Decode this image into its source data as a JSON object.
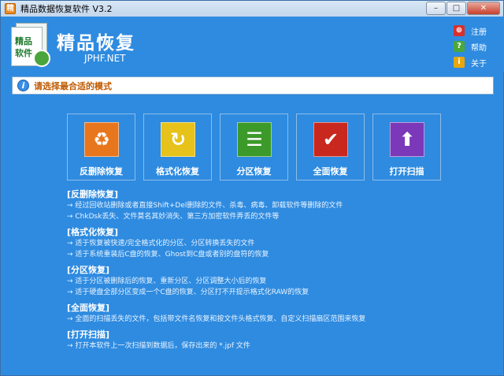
{
  "window": {
    "title": "精品数据恢复软件 V3.2",
    "controls": {
      "minimize": "–",
      "maximize": "□",
      "close": "✕"
    }
  },
  "header": {
    "logo_text": "精品软件",
    "app_name": "精品恢复",
    "app_subtitle": "JPHF.NET",
    "links": [
      {
        "label": "注册",
        "icon": "cart-icon",
        "color": "#d9302b",
        "glyph": "⊕"
      },
      {
        "label": "帮助",
        "icon": "help-icon",
        "color": "#4aa83a",
        "glyph": "?"
      },
      {
        "label": "关于",
        "icon": "info-icon",
        "color": "#e8a80c",
        "glyph": "i"
      }
    ]
  },
  "hint": {
    "text": "请选择最合适的模式"
  },
  "modes": [
    {
      "label": "反删除恢复",
      "icon": "recycle-icon",
      "color": "#e8761c",
      "glyph": "♻"
    },
    {
      "label": "格式化恢复",
      "icon": "refresh-icon",
      "color": "#e6c21a",
      "glyph": "↻"
    },
    {
      "label": "分区恢复",
      "icon": "checklist-icon",
      "color": "#3c9a2a",
      "glyph": "☰"
    },
    {
      "label": "全面恢复",
      "icon": "checkbox-icon",
      "color": "#c8281e",
      "glyph": "✔"
    },
    {
      "label": "打开扫描",
      "icon": "upload-arrow-icon",
      "color": "#7b38b8",
      "glyph": "⬆"
    }
  ],
  "descriptions": [
    {
      "title": "[反删除恢复]",
      "lines": [
        "→ 经过回收站删除或者直接Shift+Del删除的文件、杀毒、病毒、卸载软件等删除的文件",
        "→ ChkDsk丢失、文件莫名其妙消失、第三方加密软件弄丢的文件等"
      ]
    },
    {
      "title": "[格式化恢复]",
      "lines": [
        "→ 适于恢复被快速/完全格式化的分区、分区转换丢失的文件",
        "→ 适于系统重装后C盘的恢复、Ghost到C盘或者别的盘符的恢复"
      ]
    },
    {
      "title": "[分区恢复]",
      "lines": [
        "→ 适于分区被删除后的恢复、重新分区、分区调整大小后的恢复",
        "→ 适于硬盘全部分区变成一个C盘的恢复、分区打不开提示格式化RAW的恢复"
      ]
    },
    {
      "title": "[全面恢复]",
      "lines": [
        "→ 全面的扫描丢失的文件，包括带文件名恢复和按文件头格式恢复、自定义扫描扇区范围来恢复"
      ]
    },
    {
      "title": "[打开扫描]",
      "lines": [
        "→ 打开本软件上一次扫描到数据后，保存出来的 *.jpf 文件"
      ]
    }
  ]
}
